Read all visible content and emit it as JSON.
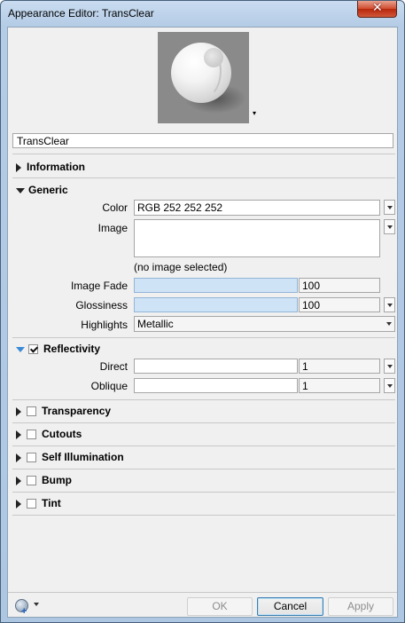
{
  "window": {
    "title": "Appearance Editor: TransClear",
    "close_glyph": "✕"
  },
  "preview": {
    "dropdown_glyph": "▾"
  },
  "name": "TransClear",
  "sections": {
    "information": {
      "label": "Information"
    },
    "generic": {
      "label": "Generic",
      "color_label": "Color",
      "color_value": "RGB 252 252 252",
      "image_label": "Image",
      "image_hint": "(no image selected)",
      "image_fade_label": "Image Fade",
      "image_fade_value": "100",
      "glossiness_label": "Glossiness",
      "glossiness_value": "100",
      "highlights_label": "Highlights",
      "highlights_value": "Metallic"
    },
    "reflectivity": {
      "label": "Reflectivity",
      "checked": true,
      "direct_label": "Direct",
      "direct_value": "1",
      "oblique_label": "Oblique",
      "oblique_value": "1"
    },
    "transparency": {
      "label": "Transparency",
      "checked": false
    },
    "cutouts": {
      "label": "Cutouts",
      "checked": false
    },
    "self_illumination": {
      "label": "Self Illumination",
      "checked": false
    },
    "bump": {
      "label": "Bump",
      "checked": false
    },
    "tint": {
      "label": "Tint",
      "checked": false
    }
  },
  "footer": {
    "ok_label": "OK",
    "cancel_label": "Cancel",
    "apply_label": "Apply"
  },
  "colors": {
    "accent": "#3a8ad6",
    "slider_fill": "#cfe3f7",
    "close": "#cf4b2e"
  }
}
